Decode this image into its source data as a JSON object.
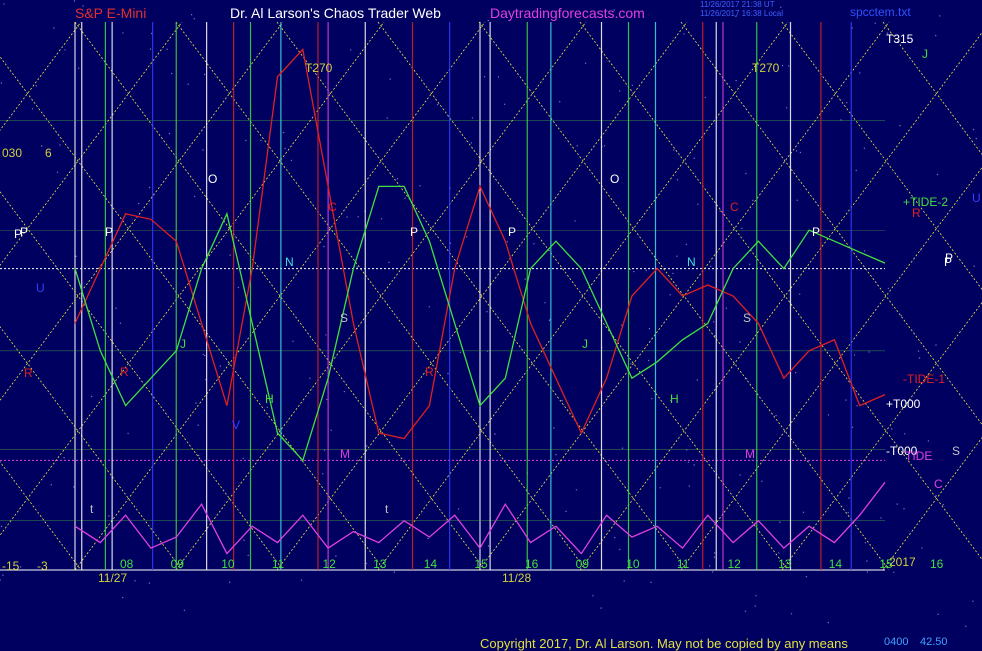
{
  "header": {
    "instrument": "S&P E-Mini",
    "author": "Dr. Al Larson's Chaos Trader Web",
    "site": "Daytradingforecasts.com",
    "timestamp_1": "11/26/2017 21:38 UT",
    "timestamp_2": "11/26/2017 16:38 Local",
    "file": "spcctem.txt"
  },
  "footer": {
    "copyright": "Copyright 2017, Dr. Al Larson. May not be copied by any means",
    "readout_a": "0400",
    "readout_b": "42.50"
  },
  "colors": {
    "background": "#000060",
    "grid_yellow": "#e8e840",
    "red_line": "#e02020",
    "green_line": "#40e040",
    "magenta_line": "#e040e0",
    "cyan_line": "#40e0e0",
    "white_line": "#ffffff",
    "blue_label": "#3040ff",
    "olive_label": "#d0d040"
  },
  "chart_data": {
    "type": "line",
    "title": "S&P E-Mini",
    "xlabel": "",
    "ylabel": "",
    "x_dates": [
      "11/27",
      "11/28"
    ],
    "x_ticks": [
      "08",
      "09",
      "10",
      "11",
      "12",
      "13",
      "14",
      "15",
      "16",
      "09",
      "10",
      "11",
      "12",
      "13",
      "14",
      "15",
      "16"
    ],
    "ylim": [
      0,
      1
    ],
    "series": [
      {
        "name": "",
        "color": "red",
        "hours": [
          8,
          8.5,
          9,
          9.5,
          10,
          10.5,
          11,
          11.5,
          12,
          12.5,
          13,
          13.5,
          14,
          14.5,
          15,
          15.5,
          16,
          16.5,
          17,
          17.5,
          18,
          18.5,
          19,
          19.5,
          20,
          20.5,
          21,
          21.5,
          22,
          22.5,
          23,
          23.5,
          24
        ],
        "values": [
          0.45,
          0.55,
          0.65,
          0.64,
          0.6,
          0.45,
          0.3,
          0.55,
          0.9,
          0.95,
          0.7,
          0.45,
          0.25,
          0.24,
          0.3,
          0.55,
          0.7,
          0.6,
          0.45,
          0.35,
          0.25,
          0.35,
          0.5,
          0.55,
          0.5,
          0.52,
          0.5,
          0.45,
          0.35,
          0.4,
          0.42,
          0.3,
          0.32
        ]
      },
      {
        "name": "",
        "color": "green",
        "hours": [
          8,
          8.5,
          9,
          9.5,
          10,
          10.5,
          11,
          11.5,
          12,
          12.5,
          13,
          13.5,
          14,
          14.5,
          15,
          15.5,
          16,
          16.5,
          17,
          17.5,
          18,
          18.5,
          19,
          19.5,
          20,
          20.5,
          21,
          21.5,
          22,
          22.5,
          23,
          23.5,
          24
        ],
        "values": [
          0.55,
          0.4,
          0.3,
          0.35,
          0.4,
          0.55,
          0.65,
          0.45,
          0.25,
          0.2,
          0.35,
          0.55,
          0.7,
          0.7,
          0.6,
          0.45,
          0.3,
          0.35,
          0.55,
          0.6,
          0.55,
          0.45,
          0.35,
          0.38,
          0.42,
          0.45,
          0.55,
          0.6,
          0.55,
          0.62,
          0.6,
          0.58,
          0.56
        ]
      },
      {
        "name": "",
        "color": "magenta",
        "hours": [
          8,
          8.5,
          9,
          9.5,
          10,
          10.5,
          11,
          11.5,
          12,
          12.5,
          13,
          13.5,
          14,
          14.5,
          15,
          15.5,
          16,
          16.5,
          17,
          17.5,
          18,
          18.5,
          19,
          19.5,
          20,
          20.5,
          21,
          21.5,
          22,
          22.5,
          23,
          23.5,
          24
        ],
        "values": [
          0.08,
          0.05,
          0.1,
          0.04,
          0.06,
          0.12,
          0.03,
          0.08,
          0.05,
          0.1,
          0.04,
          0.07,
          0.05,
          0.09,
          0.06,
          0.1,
          0.04,
          0.12,
          0.05,
          0.08,
          0.03,
          0.1,
          0.06,
          0.08,
          0.04,
          0.1,
          0.05,
          0.09,
          0.04,
          0.08,
          0.05,
          0.1,
          0.16
        ]
      }
    ],
    "vertical_labels": [
      "P",
      "P",
      "P",
      "P",
      "P",
      "P",
      "N",
      "N",
      "S",
      "S",
      "O",
      "O",
      "J",
      "J",
      "H",
      "H",
      "R",
      "R",
      "C",
      "C",
      "M",
      "M",
      "V",
      "t",
      "t",
      "T270",
      "T270"
    ],
    "right_labels": [
      "T315",
      "J",
      "+TIDE-2",
      "R",
      "U",
      "P",
      "-TIDE-1",
      "+T000",
      "-T000",
      "TIDE",
      "S",
      "C"
    ],
    "left_labels": [
      "030",
      "6",
      "P",
      "U",
      "R",
      "-15",
      "-3"
    ],
    "year_label": "2017"
  }
}
